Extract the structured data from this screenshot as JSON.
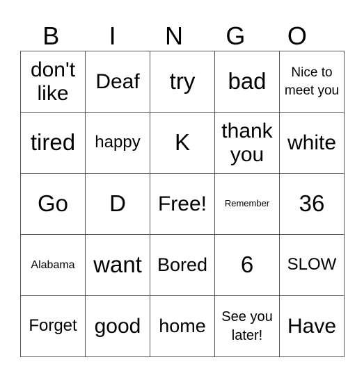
{
  "header": [
    "B",
    "I",
    "N",
    "G",
    "O"
  ],
  "rows": [
    [
      "don't like",
      "Deaf",
      "try",
      "bad",
      "Nice to meet you"
    ],
    [
      "tired",
      "happy",
      "K",
      "thank you",
      "white"
    ],
    [
      "Go",
      "D",
      "Free!",
      "Remember",
      "36"
    ],
    [
      "Alabama",
      "want",
      "Bored",
      "6",
      "SLOW"
    ],
    [
      "Forget",
      "good",
      "home",
      "See you later!",
      "Have"
    ]
  ]
}
